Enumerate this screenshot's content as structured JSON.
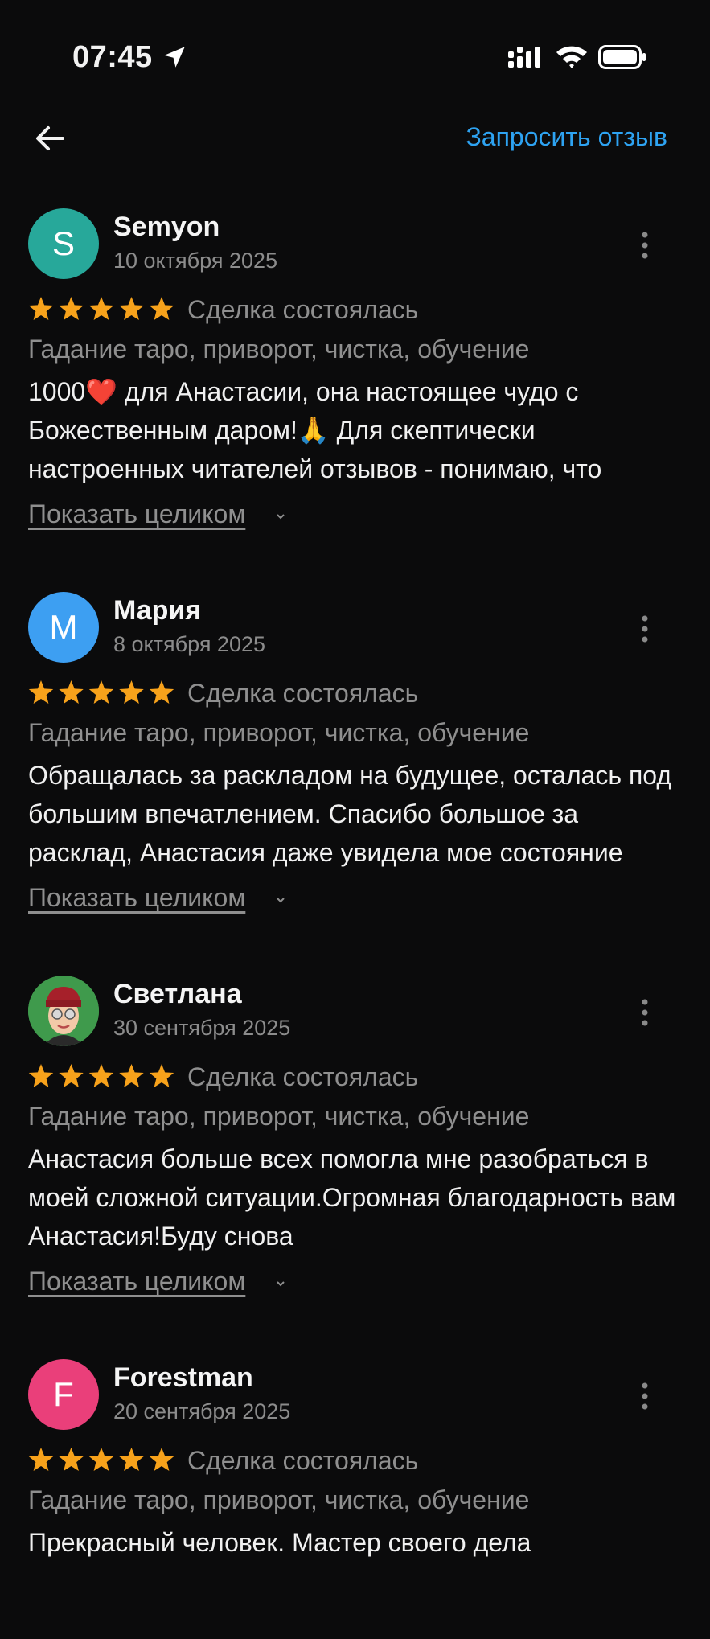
{
  "status_bar": {
    "time": "07:45"
  },
  "header": {
    "request_review": "Запросить отзыв"
  },
  "colors": {
    "accent": "#2ea3f2",
    "star": "#f7a21b"
  },
  "reviews": [
    {
      "name": "Semyon",
      "date": "10 октября 2025",
      "initial": "S",
      "avatar_color": "#27a89a",
      "rating": 5,
      "deal_status": "Сделка состоялась",
      "service": "Гадание таро, приворот, чистка, обучение",
      "text": "1000❤️ для Анастасии, она настоящее чудо с Божественным даром!🙏 Для скептически настроенных читателей отзывов - понимаю, что",
      "show_more": "Показать целиком"
    },
    {
      "name": "Мария",
      "date": "8 октября 2025",
      "initial": "М",
      "avatar_color": "#3d9ff2",
      "rating": 5,
      "deal_status": "Сделка состоялась",
      "service": "Гадание таро, приворот, чистка, обучение",
      "text": "Обращалась за раскладом на будущее, осталась под большим впечатлением. Спасибо большое за расклад, Анастасия даже увидела мое состояние",
      "show_more": "Показать целиком"
    },
    {
      "name": "Светлана",
      "date": "30 сентября 2025",
      "initial": "",
      "avatar_color": "#3f9a4c",
      "rating": 5,
      "deal_status": "Сделка состоялась",
      "service": "Гадание таро, приворот, чистка, обучение",
      "text": "Анастасия больше всех помогла мне разобраться в моей сложной ситуации.Огромная благодарность вам Анастасия!Буду снова",
      "show_more": "Показать целиком"
    },
    {
      "name": "Forestman",
      "date": "20 сентября 2025",
      "initial": "F",
      "avatar_color": "#ea3f7a",
      "rating": 5,
      "deal_status": "Сделка состоялась",
      "service": "Гадание таро, приворот, чистка, обучение",
      "text": "Прекрасный человек. Мастер своего дела",
      "show_more": ""
    }
  ]
}
